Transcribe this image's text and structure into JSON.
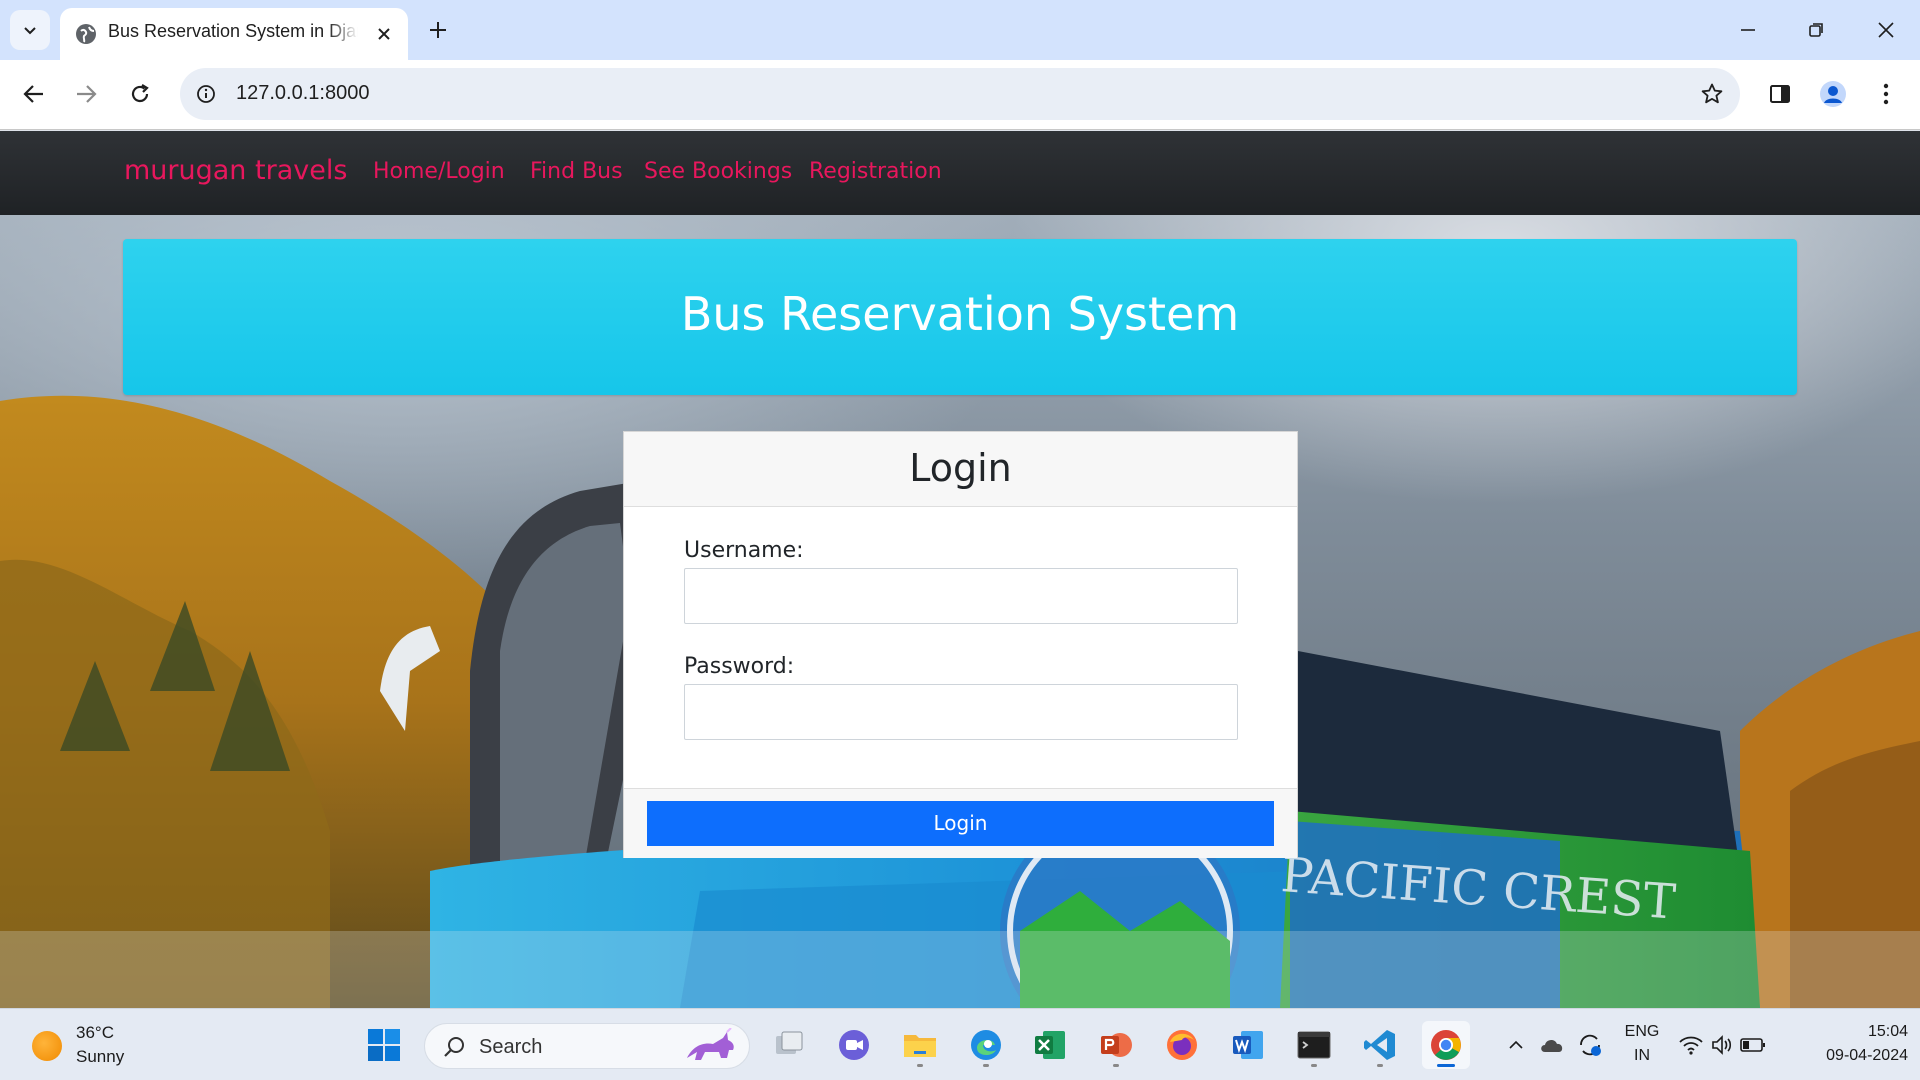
{
  "browser": {
    "tab_title": "Bus Reservation System in Django",
    "url": "127.0.0.1:8000"
  },
  "navbar": {
    "brand": "murugan travels",
    "links": [
      "Home/Login",
      "Find Bus",
      "See Bookings",
      "Registration"
    ]
  },
  "hero": {
    "title": "Bus Reservation System"
  },
  "login_card": {
    "title": "Login",
    "username_label": "Username:",
    "username_value": "",
    "password_label": "Password:",
    "password_value": "",
    "button_label": "Login"
  },
  "background_text": "PACIFIC CREST",
  "taskbar": {
    "weather_temp": "36°C",
    "weather_cond": "Sunny",
    "search_label": "Search",
    "lang_top": "ENG",
    "lang_bottom": "IN",
    "time": "15:04",
    "date": "09-04-2024"
  },
  "colors": {
    "brand_pink": "#e8175d",
    "hero_cyan": "#1fc9ec",
    "button_blue": "#0d6efd",
    "navbar_dark": "#2a2d31"
  }
}
